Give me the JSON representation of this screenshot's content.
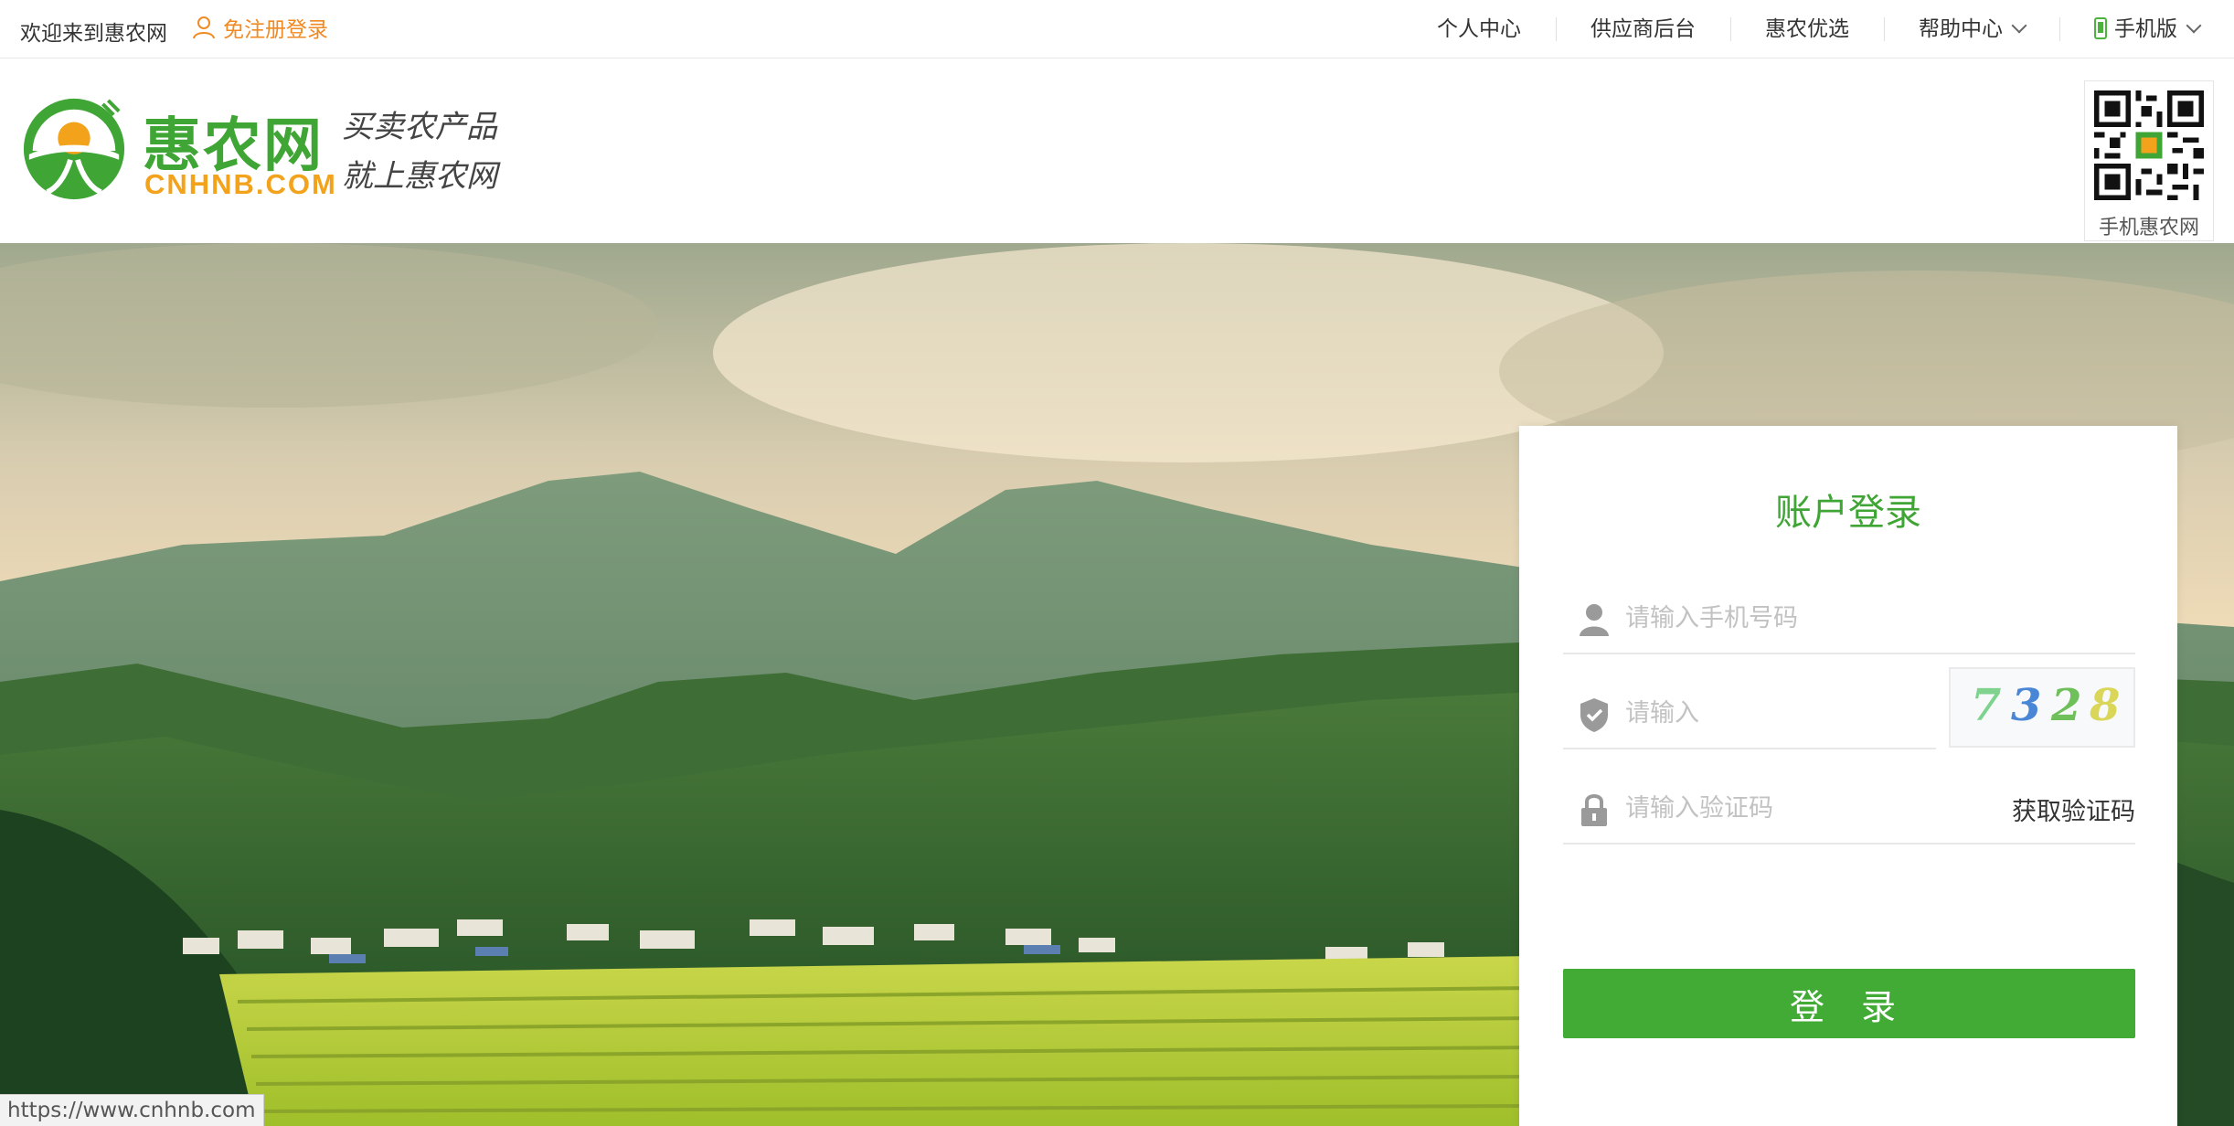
{
  "topbar": {
    "welcome": "欢迎来到惠农网",
    "register": "免注册登录",
    "nav": {
      "personal": "个人中心",
      "supplier": "供应商后台",
      "select": "惠农优选",
      "help": "帮助中心",
      "mobile": "手机版"
    }
  },
  "header": {
    "brand_cn": "惠农网",
    "brand_en": "CNHNB.COM",
    "slogan_line1": "买卖农产品",
    "slogan_line2": "就上惠农网",
    "qr_caption": "手机惠农网"
  },
  "login": {
    "title": "账户登录",
    "phone_placeholder": "请输入手机号码",
    "code_placeholder": "请输入",
    "captcha": [
      "7",
      "3",
      "2",
      "8"
    ],
    "sms_placeholder": "请输入验证码",
    "get_code": "获取验证码",
    "submit": "登 录"
  },
  "status_url": "https://www.cnhnb.com",
  "colors": {
    "brand_green": "#3fa535",
    "brand_orange": "#f3a21b",
    "register_orange": "#f08a24",
    "button_green": "#42ab35"
  }
}
